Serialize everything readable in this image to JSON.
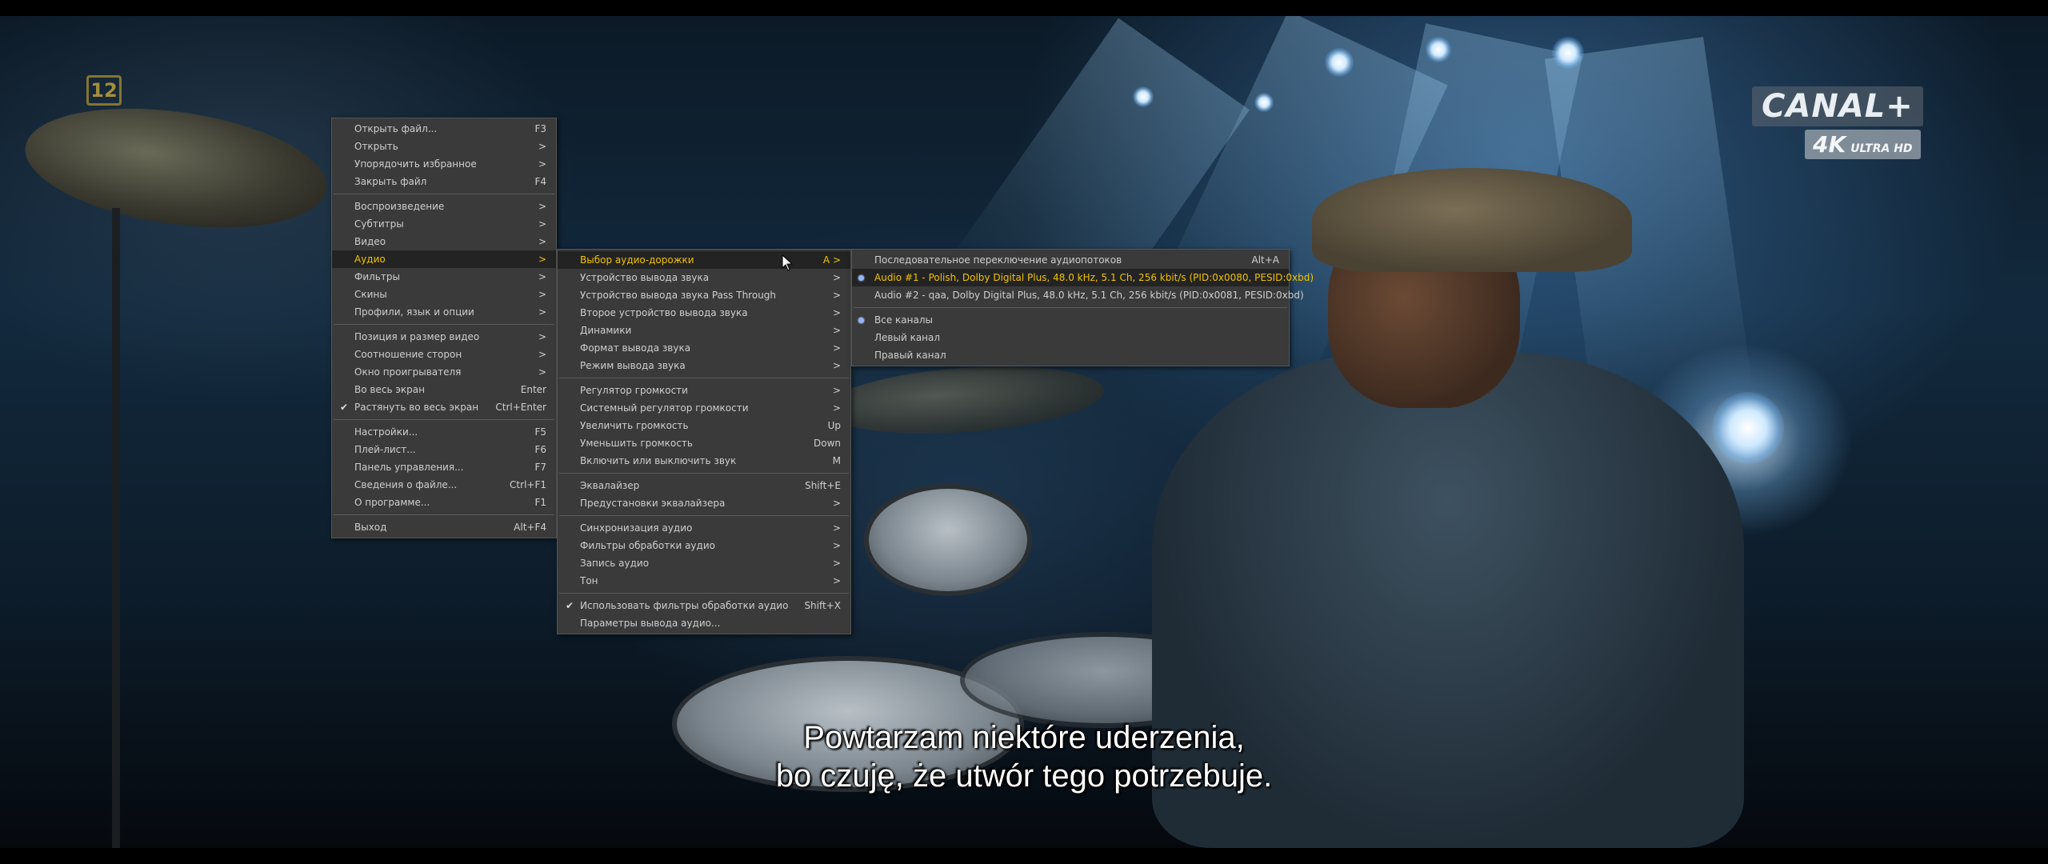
{
  "video": {
    "channel_badge": "12",
    "brand": "CANAL+",
    "brand_sub_4k": "4K",
    "brand_sub_uhd": "ULTRA HD",
    "subtitle_line1": "Powtarzam niektóre uderzenia,",
    "subtitle_line2": "bo czuję, że utwór tego potrzebuje."
  },
  "main_menu": {
    "items": [
      {
        "label": "Открыть файл...",
        "shortcut": "F3"
      },
      {
        "label": "Открыть",
        "arrow": ">"
      },
      {
        "label": "Упорядочить избранное",
        "arrow": ">"
      },
      {
        "label": "Закрыть файл",
        "shortcut": "F4"
      },
      {
        "label": "Воспроизведение",
        "arrow": ">"
      },
      {
        "label": "Субтитры",
        "arrow": ">"
      },
      {
        "label": "Видео",
        "arrow": ">"
      },
      {
        "label": "Аудио",
        "arrow": ">"
      },
      {
        "label": "Фильтры",
        "arrow": ">"
      },
      {
        "label": "Скины",
        "arrow": ">"
      },
      {
        "label": "Профили, язык и опции",
        "arrow": ">"
      },
      {
        "label": "Позиция и размер видео",
        "arrow": ">"
      },
      {
        "label": "Соотношение сторон",
        "arrow": ">"
      },
      {
        "label": "Окно проигрывателя",
        "arrow": ">"
      },
      {
        "label": "Во весь экран",
        "shortcut": "Enter"
      },
      {
        "label": "Растянуть во весь экран",
        "shortcut": "Ctrl+Enter"
      },
      {
        "label": "Настройки...",
        "shortcut": "F5"
      },
      {
        "label": "Плей-лист...",
        "shortcut": "F6"
      },
      {
        "label": "Панель управления...",
        "shortcut": "F7"
      },
      {
        "label": "Сведения о файле...",
        "shortcut": "Ctrl+F1"
      },
      {
        "label": "О программе...",
        "shortcut": "F1"
      },
      {
        "label": "Выход",
        "shortcut": "Alt+F4"
      }
    ]
  },
  "audio_menu": {
    "items": [
      {
        "label": "Выбор аудио-дорожки",
        "shortcut": "A >"
      },
      {
        "label": "Устройство вывода звука",
        "arrow": ">"
      },
      {
        "label": "Устройство вывода звука Pass Through",
        "arrow": ">"
      },
      {
        "label": "Второе устройство вывода звука",
        "arrow": ">"
      },
      {
        "label": "Динамики",
        "arrow": ">"
      },
      {
        "label": "Формат вывода звука",
        "arrow": ">"
      },
      {
        "label": "Режим вывода звука",
        "arrow": ">"
      },
      {
        "label": "Регулятор громкости",
        "arrow": ">"
      },
      {
        "label": "Системный регулятор громкости",
        "arrow": ">"
      },
      {
        "label": "Увеличить громкость",
        "shortcut": "Up"
      },
      {
        "label": "Уменьшить громкость",
        "shortcut": "Down"
      },
      {
        "label": "Включить или выключить звук",
        "shortcut": "M"
      },
      {
        "label": "Эквалайзер",
        "shortcut": "Shift+E"
      },
      {
        "label": "Предустановки эквалайзера",
        "arrow": ">"
      },
      {
        "label": "Синхронизация аудио",
        "arrow": ">"
      },
      {
        "label": "Фильтры обработки аудио",
        "arrow": ">"
      },
      {
        "label": "Запись аудио",
        "arrow": ">"
      },
      {
        "label": "Тон",
        "arrow": ">"
      },
      {
        "label": "Использовать фильтры обработки аудио",
        "shortcut": "Shift+X"
      },
      {
        "label": "Параметры вывода аудио..."
      }
    ]
  },
  "track_menu": {
    "items": [
      {
        "label": "Последовательное переключение аудиопотоков",
        "shortcut": "Alt+A"
      },
      {
        "label": "Audio #1 - Polish, Dolby Digital Plus, 48.0 kHz, 5.1 Ch, 256 kbit/s (PID:0x0080, PESID:0xbd)"
      },
      {
        "label": "Audio #2 - qaa, Dolby Digital Plus, 48.0 kHz, 5.1 Ch, 256 kbit/s (PID:0x0081, PESID:0xbd)"
      },
      {
        "label": "Все каналы"
      },
      {
        "label": "Левый канал"
      },
      {
        "label": "Правый канал"
      }
    ]
  }
}
